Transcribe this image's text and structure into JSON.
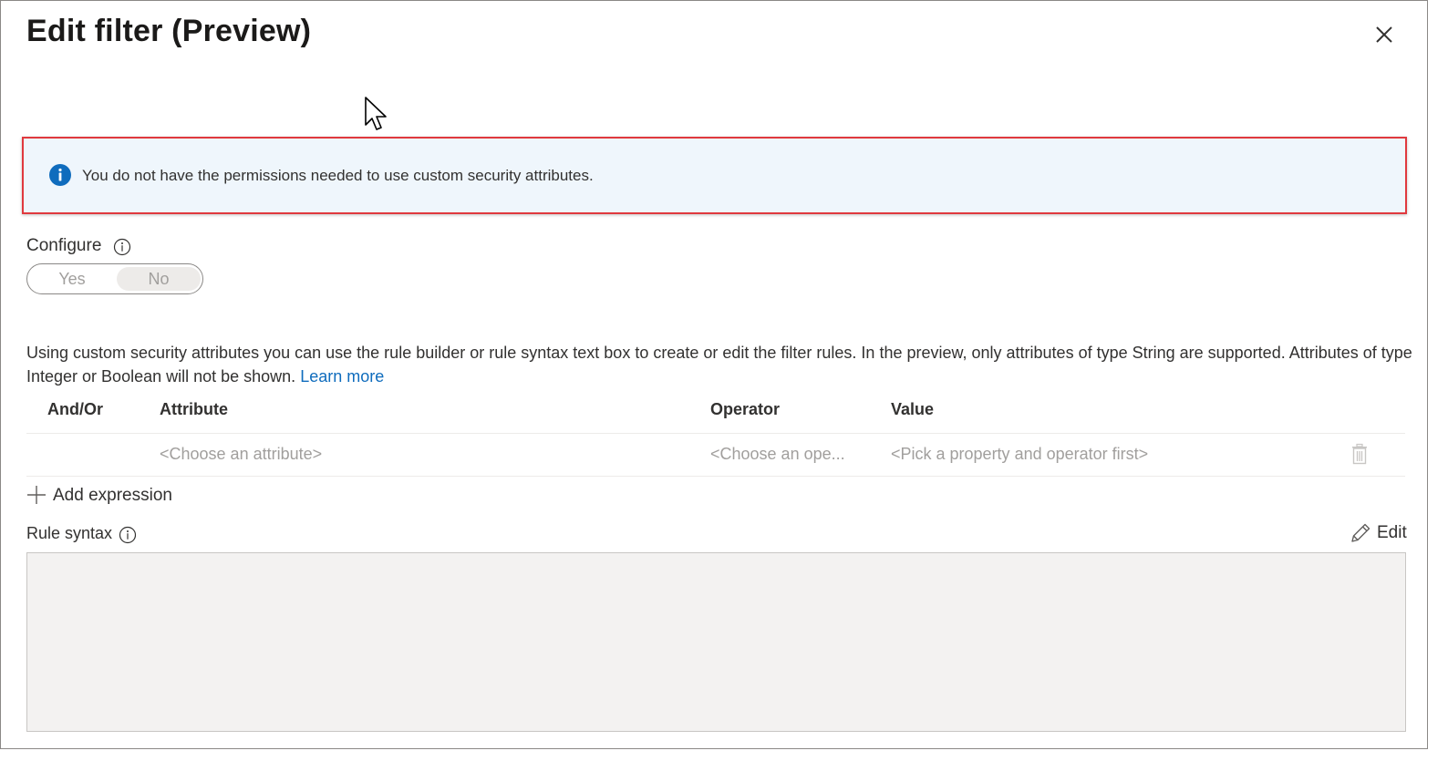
{
  "header": {
    "title": "Edit filter (Preview)",
    "close_icon": "close-icon"
  },
  "banner": {
    "icon": "info-circle-icon",
    "message": "You do not have the permissions needed to use custom security attributes.",
    "accent_color": "#0f6cbd",
    "outline_color": "#e0393e"
  },
  "configure": {
    "label": "Configure",
    "info_icon": "info-icon",
    "options": [
      "Yes",
      "No"
    ],
    "selected": "No"
  },
  "description": {
    "text": "Using custom security attributes you can use the rule builder or rule syntax text box to create or edit the filter rules. In the preview, only attributes of type String are supported. Attributes of type Integer or Boolean will not be shown.",
    "link_label": "Learn more"
  },
  "rule_builder": {
    "columns": [
      "And/Or",
      "Attribute",
      "Operator",
      "Value"
    ],
    "rows": [
      {
        "and_or": "",
        "attribute_placeholder": "<Choose an attribute>",
        "operator_placeholder": "<Choose an ope...",
        "value_placeholder": "<Pick a property and operator first>"
      }
    ],
    "add_expression_label": "Add expression"
  },
  "rule_syntax": {
    "label": "Rule syntax",
    "edit_label": "Edit",
    "value": ""
  }
}
